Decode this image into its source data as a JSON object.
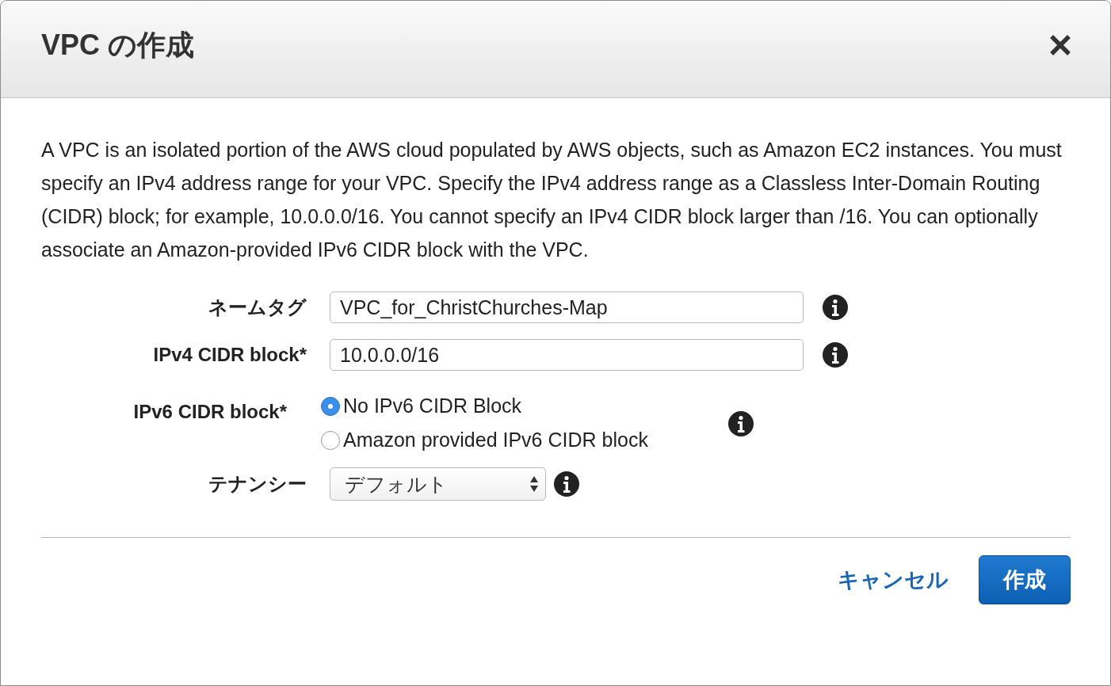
{
  "dialog": {
    "title": "VPC の作成",
    "description": "A VPC is an isolated portion of the AWS cloud populated by AWS objects, such as Amazon EC2 instances. You must specify an IPv4 address range for your VPC. Specify the IPv4 address range as a Classless Inter-Domain Routing (CIDR) block; for example, 10.0.0.0/16. You cannot specify an IPv4 CIDR block larger than /16. You can optionally associate an Amazon-provided IPv6 CIDR block with the VPC.",
    "fields": [
      {
        "kind": "text",
        "label": "ネームタグ",
        "value": "VPC_for_ChristChurches-Map"
      },
      {
        "kind": "text",
        "label": "IPv4 CIDR block*",
        "value": "10.0.0.0/16"
      },
      {
        "kind": "radio",
        "label": "IPv6 CIDR block*",
        "options": [
          {
            "label": "No IPv6 CIDR Block",
            "selected": true
          },
          {
            "label": "Amazon provided IPv6 CIDR block",
            "selected": false
          }
        ]
      },
      {
        "kind": "select",
        "label": "テナンシー",
        "value": "デフォルト"
      }
    ],
    "buttons": [
      {
        "kind": "link",
        "label": "キャンセル"
      },
      {
        "kind": "primary",
        "label": "作成"
      }
    ]
  }
}
